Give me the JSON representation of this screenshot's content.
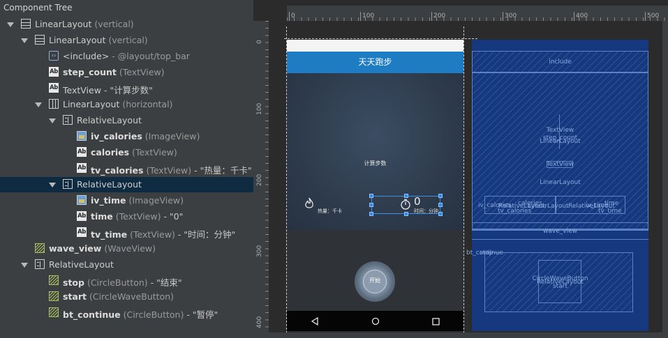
{
  "panel_title": "Component Tree",
  "tree": [
    {
      "depth": 0,
      "expand": true,
      "icon": "vert",
      "name": "LinearLayout",
      "type": "(vertical)",
      "value": "",
      "bold": false
    },
    {
      "depth": 1,
      "expand": true,
      "icon": "vert",
      "name": "LinearLayout",
      "type": "(vertical)",
      "value": "",
      "bold": false
    },
    {
      "depth": 2,
      "expand": false,
      "icon": "inc",
      "name": "<include>",
      "type": "- @layout/top_bar",
      "value": "",
      "bold": false
    },
    {
      "depth": 2,
      "expand": false,
      "icon": "ab",
      "name": "step_count",
      "type": "(TextView)",
      "value": "",
      "bold": true
    },
    {
      "depth": 2,
      "expand": false,
      "icon": "ab",
      "name": "TextView",
      "type": "",
      "value": "- \"计算步数\"",
      "bold": false
    },
    {
      "depth": 2,
      "expand": true,
      "icon": "horz",
      "name": "LinearLayout",
      "type": "(horizontal)",
      "value": "",
      "bold": false
    },
    {
      "depth": 3,
      "expand": true,
      "icon": "rel",
      "name": "RelativeLayout",
      "type": "",
      "value": "",
      "bold": false
    },
    {
      "depth": 4,
      "expand": false,
      "icon": "img",
      "name": "iv_calories",
      "type": "(ImageView)",
      "value": "",
      "bold": true
    },
    {
      "depth": 4,
      "expand": false,
      "icon": "ab",
      "name": "calories",
      "type": "(TextView)",
      "value": "",
      "bold": true
    },
    {
      "depth": 4,
      "expand": false,
      "icon": "ab",
      "name": "tv_calories",
      "type": "(TextView)",
      "value": "- \"热量：千卡\"",
      "bold": true
    },
    {
      "depth": 3,
      "expand": true,
      "icon": "rel",
      "name": "RelativeLayout",
      "type": "",
      "value": "",
      "bold": false,
      "selected": true
    },
    {
      "depth": 4,
      "expand": false,
      "icon": "img",
      "name": "iv_time",
      "type": "(ImageView)",
      "value": "",
      "bold": true
    },
    {
      "depth": 4,
      "expand": false,
      "icon": "ab",
      "name": "time",
      "type": "(TextView)",
      "value": "- \"0\"",
      "bold": true
    },
    {
      "depth": 4,
      "expand": false,
      "icon": "ab",
      "name": "tv_time",
      "type": "(TextView)",
      "value": "- \"时间：分钟\"",
      "bold": true
    },
    {
      "depth": 1,
      "expand": false,
      "icon": "custom",
      "name": "wave_view",
      "type": "(WaveView)",
      "value": "",
      "bold": true
    },
    {
      "depth": 1,
      "expand": true,
      "icon": "rel",
      "name": "RelativeLayout",
      "type": "",
      "value": "",
      "bold": false
    },
    {
      "depth": 2,
      "expand": false,
      "icon": "custom",
      "name": "stop",
      "type": "(CircleButton)",
      "value": "- \"结束\"",
      "bold": true
    },
    {
      "depth": 2,
      "expand": false,
      "icon": "custom",
      "name": "start",
      "type": "(CircleWaveButton)",
      "value": "",
      "bold": true
    },
    {
      "depth": 2,
      "expand": false,
      "icon": "custom",
      "name": "bt_continue",
      "type": "(CircleButton)",
      "value": "- \"暂停\"",
      "bold": true
    }
  ],
  "ruler_h": [
    "0",
    "100",
    "200",
    "300",
    "400",
    "500"
  ],
  "ruler_v": [
    "0",
    "100",
    "200",
    "300",
    "400"
  ],
  "phone": {
    "title": "天天跑步",
    "step_label": "计算步数",
    "calories_label": "热量：千卡",
    "time_value": "0",
    "time_label": "时间：分钟",
    "start_label": "开始"
  },
  "blueprint": {
    "include": "include",
    "textview_step": "TextView",
    "step_count": "step_count",
    "linearlayout": "LinearLayout",
    "textview2": "TextView",
    "linearlayout2": "LinearLayout",
    "iv_calories": "iv_calories",
    "calories": "calories",
    "relativelayout": "RelativeLayout",
    "tv_calories": "tv_calories",
    "linearlayout3": "LinearLayout",
    "relativelayout2": "RelativeLayout",
    "iv_time": "iv_time",
    "time": "time",
    "tv_time": "tv_time",
    "wave_view": "wave_view",
    "bt_continue": "bt_continue",
    "stop": "stop",
    "circle_wave": "CircleWaveButton",
    "relativelayout3": "RelativeLayout",
    "start": "start"
  }
}
